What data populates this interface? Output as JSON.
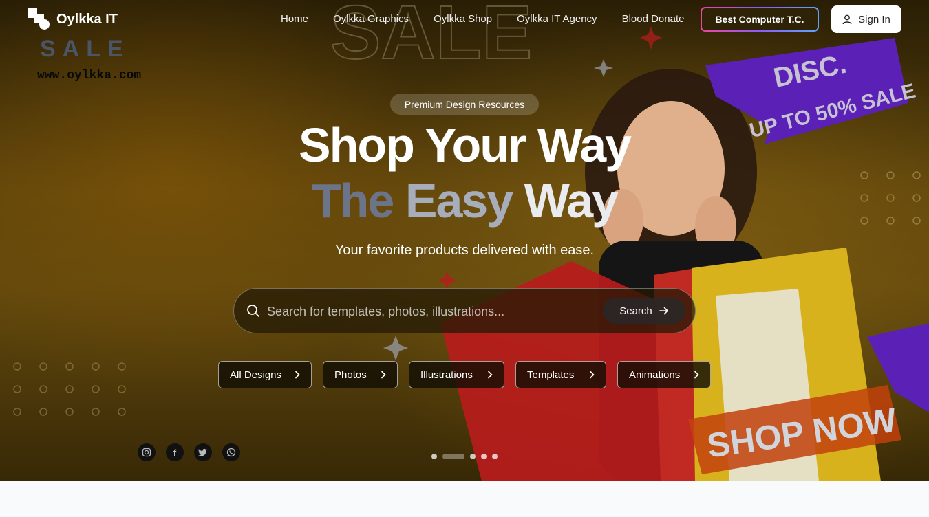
{
  "nav": {
    "logo_text": "Oylkka IT",
    "links": [
      "Home",
      "Oylkka Graphics",
      "Oylkka Shop",
      "Oylkka IT Agency",
      "Blood Donate"
    ],
    "cta_label": "Best Computer T.C.",
    "signin_label": "Sign In"
  },
  "hero": {
    "badge": "Premium Design Resources",
    "title_line1": "Shop Your Way",
    "title_line2_words": [
      "The",
      "Easy",
      "Way"
    ],
    "subtitle": "Your favorite products delivered with ease.",
    "search": {
      "placeholder": "Search for templates, photos, illustrations...",
      "button_label": "Search"
    },
    "categories": [
      "All Designs",
      "Photos",
      "Illustrations",
      "Templates",
      "Animations"
    ],
    "socials": [
      "instagram-icon",
      "facebook-icon",
      "twitter-icon",
      "whatsapp-icon"
    ],
    "slides": {
      "total": 5,
      "active": 2
    },
    "background_text": {
      "sale_label": "SALE",
      "website": "www.oylkka.com",
      "disc_line1": "DISC.",
      "disc_line2": "UP TO 50% SALE",
      "shop_now": "SHOP NOW"
    }
  },
  "colors": {
    "hero_bg": "#6d4f0d",
    "accent_gradient": [
      "#ec4899",
      "#8b5cf6",
      "#60a5fa"
    ],
    "ribbon_purple": "#5b21b6",
    "bag_red": "#b91c1c"
  }
}
